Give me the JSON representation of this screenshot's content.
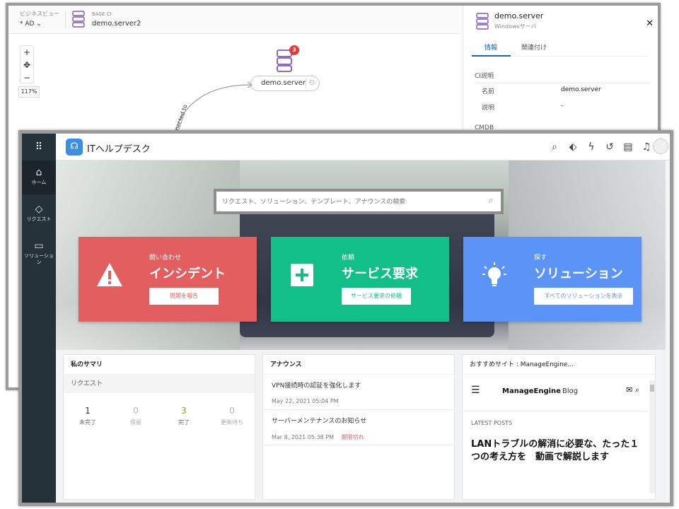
{
  "back_window": {
    "business_view_label": "ビジネスビュー",
    "business_view_value": "* AD ⌄",
    "base_ci_label": "BASE CI",
    "base_ci_value": "demo.server2",
    "zoom": {
      "plus": "+",
      "center": "✥",
      "minus": "−",
      "percent": "117%"
    },
    "node": {
      "name": "demo.server",
      "badge": "3"
    },
    "edge_label": "Connected to",
    "panel": {
      "title": "demo.server",
      "subtitle": "Windowsサーバ",
      "close": "✕",
      "tabs": [
        "情報",
        "関連付け"
      ],
      "section": "CI説明",
      "fields": [
        {
          "key": "名前",
          "value": "demo.server"
        },
        {
          "key": "説明",
          "value": "-"
        }
      ],
      "cmdb_label": "CMDB"
    }
  },
  "front_window": {
    "apps_icon": "⠿",
    "brand": {
      "logo_icon": "headset-icon",
      "name": "ITヘルプデスク"
    },
    "toolbar_icons": [
      "search-icon",
      "tag-icon",
      "bolt-icon",
      "history-icon",
      "notes-icon",
      "bell-icon"
    ],
    "sidebar": [
      {
        "icon": "home-icon",
        "label": "ホーム",
        "active": true
      },
      {
        "icon": "request-icon",
        "label": "リクエスト",
        "active": false
      },
      {
        "icon": "book-icon",
        "label": "ソリューション",
        "active": false
      }
    ],
    "search": {
      "placeholder": "リクエスト、ソリューション、テンプレート、アナウンスの検索"
    },
    "cards": [
      {
        "small": "問い合わせ",
        "big": "インシデント",
        "button": "問題を報告",
        "icon": "warning-icon",
        "color": "#e35f5f"
      },
      {
        "small": "依頼",
        "big": "サービス要求",
        "button": "サービス要求の依頼",
        "icon": "plus-icon",
        "color": "#12bf86"
      },
      {
        "small": "探す",
        "big": "ソリューション",
        "button": "すべてのソリューションを表示",
        "icon": "lightbulb-icon",
        "color": "#5b94f6"
      }
    ],
    "summary": {
      "title": "私のサマリ",
      "sub": "リクエスト",
      "stats": [
        {
          "value": "1",
          "label": "未完了"
        },
        {
          "value": "0",
          "label": "保留"
        },
        {
          "value": "3",
          "label": "完了"
        },
        {
          "value": "0",
          "label": "更新待ち"
        }
      ]
    },
    "announcements": {
      "title": "アナウンス",
      "items": [
        {
          "title": "VPN接続時の認証を強化します",
          "date": "May 22, 2021 05:04 PM",
          "status": ""
        },
        {
          "title": "サーバーメンテナンスのお知らせ",
          "date": "Mar 8, 2021 05:38 PM",
          "status": "期限切れ"
        }
      ]
    },
    "recommended": {
      "title": "おすすめサイト : ManageEngine...",
      "brand": "ManageEngine",
      "brand_suffix": "Blog",
      "latest_label": "LATEST POSTS",
      "post_title": "LANトラブルの解消に必要な、たった１つの考え方を　動画で解説します"
    }
  }
}
